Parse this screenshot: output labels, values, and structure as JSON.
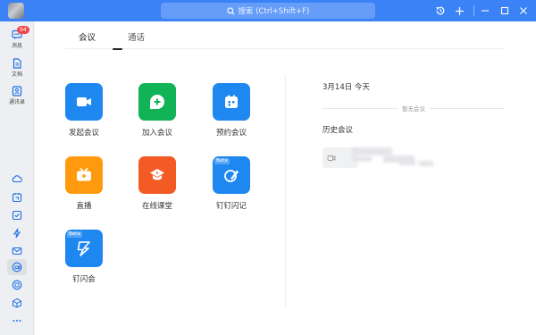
{
  "titlebar": {
    "search_placeholder": "搜索 (Ctrl+Shift+F)",
    "accent": "#3b82f6"
  },
  "sidebar": {
    "items": [
      {
        "label": "消息",
        "badge": "94",
        "icon": "message-icon"
      },
      {
        "label": "文档",
        "icon": "document-icon"
      },
      {
        "label": "通讯录",
        "icon": "contacts-icon"
      }
    ],
    "tools": [
      "cloud-drive-icon",
      "calendar-icon",
      "todo-icon",
      "ding-icon",
      "mail-icon",
      "meeting-icon",
      "note-icon",
      "box-icon",
      "more-icon"
    ]
  },
  "tabs": [
    {
      "label": "会议",
      "active": true
    },
    {
      "label": "通话",
      "active": false
    }
  ],
  "apps": [
    {
      "label": "发起会议",
      "icon": "video-camera-icon",
      "color": "#1e88f0"
    },
    {
      "label": "加入会议",
      "icon": "join-plus-icon",
      "color": "#12b357"
    },
    {
      "label": "预约会议",
      "icon": "calendar-schedule-icon",
      "color": "#1e88f0"
    },
    {
      "label": "直播",
      "icon": "tv-live-icon",
      "color": "#ff9a0f"
    },
    {
      "label": "在线课堂",
      "icon": "classroom-cap-icon",
      "color": "#f45a24"
    },
    {
      "label": "钉钉闪记",
      "icon": "flash-note-icon",
      "color": "#1e88f0",
      "tag": "Beta"
    },
    {
      "label": "钉闪会",
      "icon": "flash-meeting-icon",
      "color": "#1e88f0",
      "tag": "Beta"
    }
  ],
  "right_panel": {
    "date": "3月14日 今天",
    "empty_text": "暂无会议",
    "history_title": "历史会议"
  }
}
